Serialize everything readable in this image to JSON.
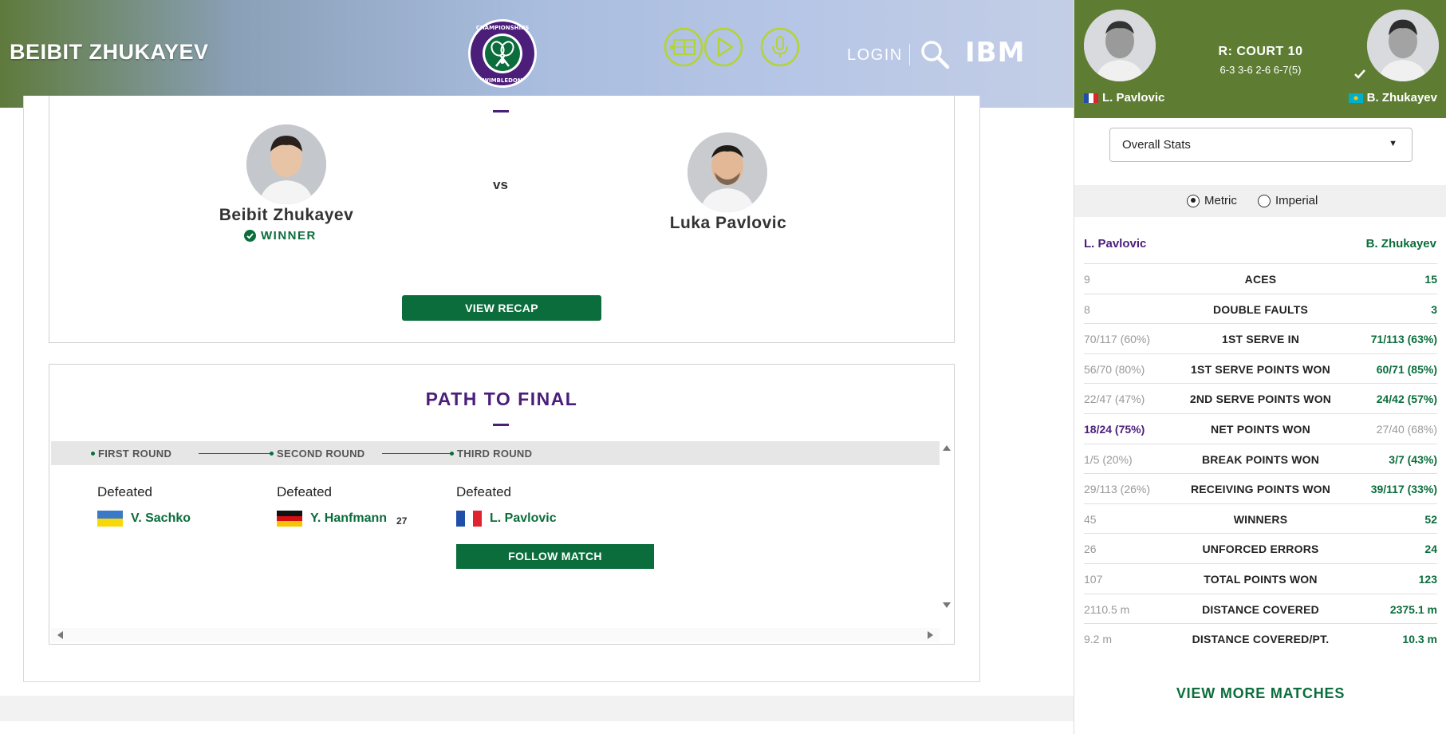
{
  "header": {
    "title": "BEIBIT ZHUKAYEV",
    "logo_text": "THE CHAMPIONSHIPS WIMBLEDON",
    "icons": [
      "court-icon",
      "play-icon",
      "microphone-icon"
    ],
    "login": "LOGIN",
    "brand": "IBM"
  },
  "match": {
    "player1": {
      "name": "Beibit Zhukayev",
      "status": "WINNER"
    },
    "vs": "vs",
    "player2": {
      "name": "Luka Pavlovic"
    },
    "recap_button": "VIEW RECAP"
  },
  "path": {
    "title": "PATH TO FINAL",
    "rounds": [
      {
        "label": "FIRST ROUND",
        "result": "Defeated",
        "opponent": "V. Sachko",
        "seed": "",
        "flag": "ukraine"
      },
      {
        "label": "SECOND ROUND",
        "result": "Defeated",
        "opponent": "Y. Hanfmann",
        "seed": "27",
        "flag": "germany"
      },
      {
        "label": "THIRD ROUND",
        "result": "Defeated",
        "opponent": "L. Pavlovic",
        "seed": "",
        "flag": "france"
      }
    ],
    "follow_button": "FOLLOW MATCH"
  },
  "panel": {
    "court": "R: COURT 10",
    "score": "6-3 3-6 2-6 6-7(5)",
    "left_player": "L. Pavlovic",
    "right_player": "B. Zhukayev",
    "dropdown": "Overall Stats",
    "units": {
      "metric": "Metric",
      "imperial": "Imperial",
      "selected": "metric"
    },
    "stats": [
      {
        "left": "9",
        "label": "ACES",
        "right": "15",
        "leader": "right"
      },
      {
        "left": "8",
        "label": "DOUBLE FAULTS",
        "right": "3",
        "leader": "right"
      },
      {
        "left": "70/117 (60%)",
        "label": "1ST SERVE IN",
        "right": "71/113 (63%)",
        "leader": "right"
      },
      {
        "left": "56/70 (80%)",
        "label": "1ST SERVE POINTS WON",
        "right": "60/71 (85%)",
        "leader": "right"
      },
      {
        "left": "22/47 (47%)",
        "label": "2ND SERVE POINTS WON",
        "right": "24/42 (57%)",
        "leader": "right"
      },
      {
        "left": "18/24 (75%)",
        "label": "NET POINTS WON",
        "right": "27/40 (68%)",
        "leader": "left"
      },
      {
        "left": "1/5 (20%)",
        "label": "BREAK POINTS WON",
        "right": "3/7 (43%)",
        "leader": "right"
      },
      {
        "left": "29/113 (26%)",
        "label": "RECEIVING POINTS WON",
        "right": "39/117 (33%)",
        "leader": "right"
      },
      {
        "left": "45",
        "label": "WINNERS",
        "right": "52",
        "leader": "right"
      },
      {
        "left": "26",
        "label": "UNFORCED ERRORS",
        "right": "24",
        "leader": "right"
      },
      {
        "left": "107",
        "label": "TOTAL POINTS WON",
        "right": "123",
        "leader": "right"
      },
      {
        "left": "2110.5 m",
        "label": "DISTANCE COVERED",
        "right": "2375.1 m",
        "leader": "right"
      },
      {
        "left": "9.2 m",
        "label": "DISTANCE COVERED/PT.",
        "right": "10.3 m",
        "leader": "right"
      }
    ],
    "view_more": "VIEW MORE MATCHES"
  },
  "colors": {
    "wimbledon_green": "#0b6d3c",
    "wimbledon_purple": "#4b1e7a",
    "panel_header": "#5e7d33",
    "icon_lime": "#b4d432"
  }
}
